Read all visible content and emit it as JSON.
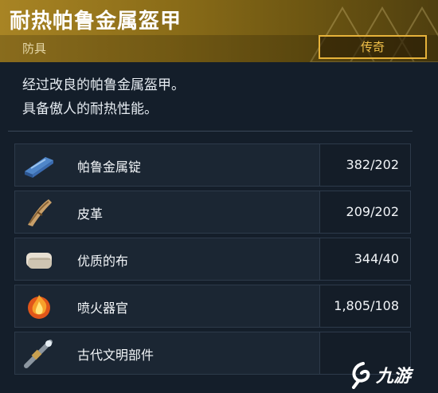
{
  "item": {
    "title": "耐热帕鲁金属盔甲",
    "category": "防具",
    "rarity": "传奇",
    "description_line1": "经过改良的帕鲁金属盔甲。",
    "description_line2": "具备傲人的耐热性能。"
  },
  "materials": [
    {
      "name": "帕鲁金属锭",
      "quantity": "382/202",
      "icon": "metal-ingot-icon"
    },
    {
      "name": "皮革",
      "quantity": "209/202",
      "icon": "leather-icon"
    },
    {
      "name": "优质的布",
      "quantity": "344/40",
      "icon": "cloth-icon"
    },
    {
      "name": "喷火器官",
      "quantity": "1,805/108",
      "icon": "flame-organ-icon"
    },
    {
      "name": "古代文明部件",
      "quantity": "",
      "icon": "ancient-part-icon"
    }
  ],
  "watermark": {
    "text": "九游"
  },
  "colors": {
    "header_gold": "#a88424",
    "rarity_border": "#e6b23a",
    "panel": "#141e2a"
  }
}
